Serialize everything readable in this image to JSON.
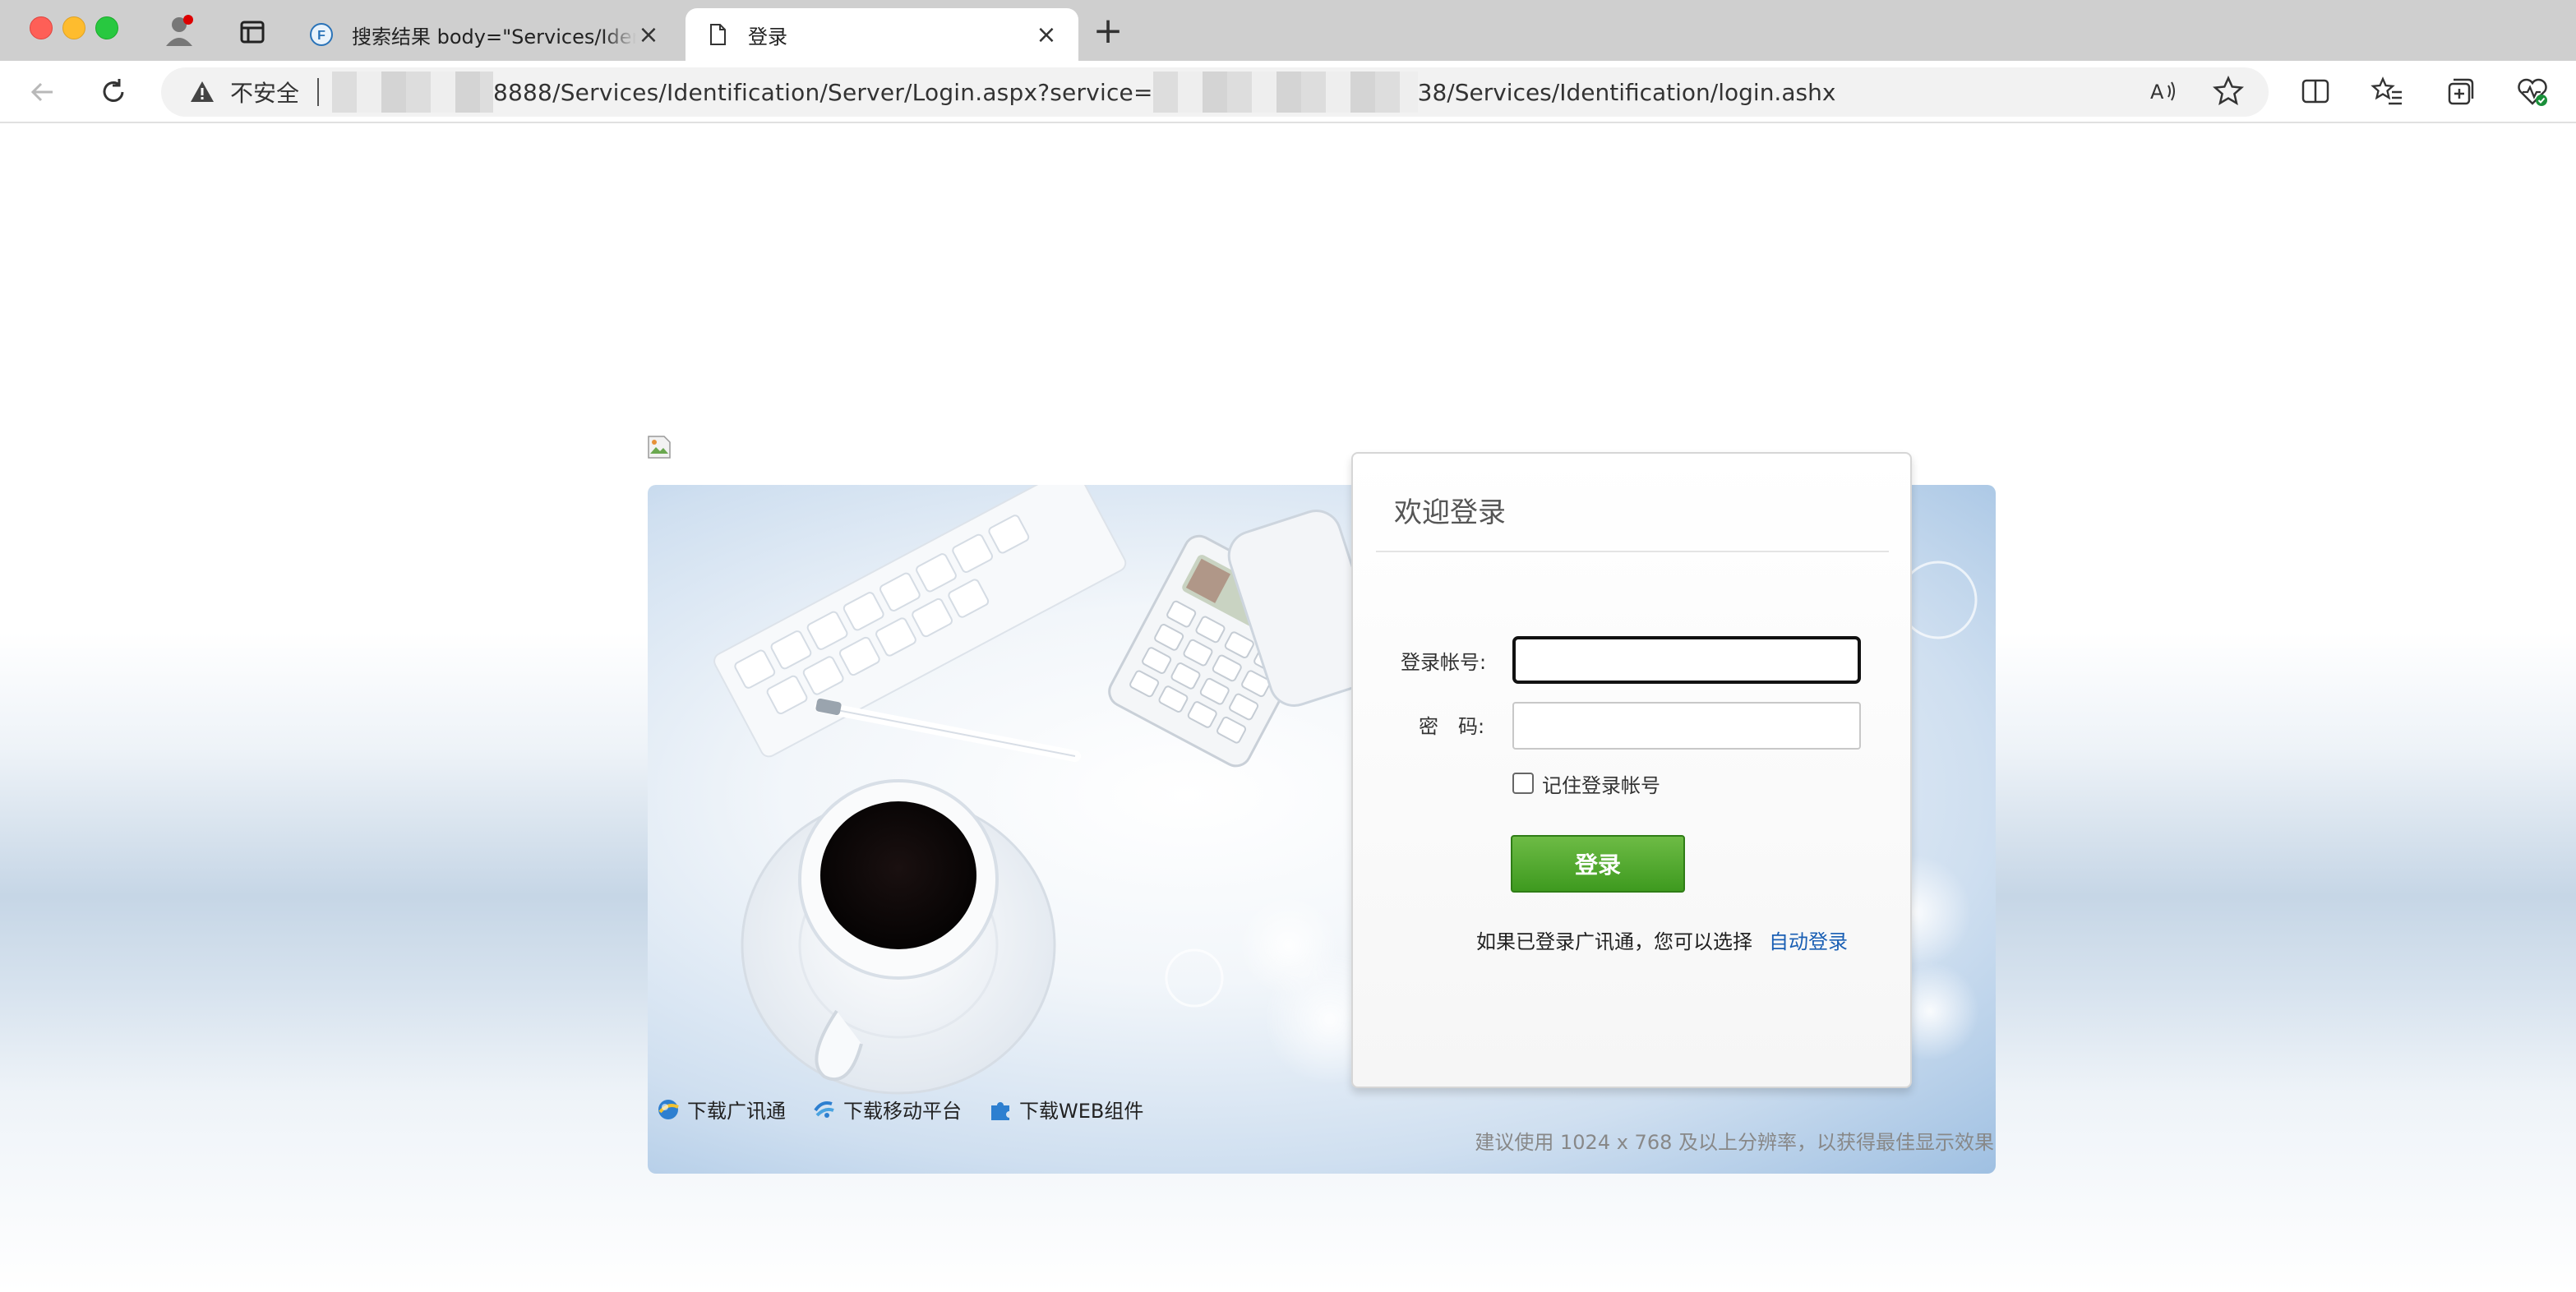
{
  "browser": {
    "tabs": [
      {
        "title": "搜索结果 body=\"Services/Identification/Server/Login.aspx\"",
        "favicon": "fofa-icon"
      },
      {
        "title": "登录",
        "favicon": "page-icon",
        "active": true
      }
    ],
    "address_bar": {
      "security_label": "不安全",
      "url_part1": "8888/Services/Identification/Server/Login.aspx?service=",
      "url_part2": "38/Services/Identification/login.ashx"
    }
  },
  "login": {
    "title": "欢迎登录",
    "account_label": "登录帐号:",
    "password_label": "密　码:",
    "account_value": "",
    "password_value": "",
    "remember_label": "记住登录帐号",
    "submit_label": "登录",
    "auto_login_hint": "如果已登录广讯通，您可以选择",
    "auto_login_link": "自动登录"
  },
  "downloads": [
    {
      "label": "下载广讯通",
      "icon": "gxt-globe-icon"
    },
    {
      "label": "下载移动平台",
      "icon": "mobile-platform-icon"
    },
    {
      "label": "下载WEB组件",
      "icon": "puzzle-icon"
    }
  ],
  "resolution_hint": "建议使用 1024 x 768 及以上分辨率，以获得最佳显示效果",
  "colors": {
    "login_button": "#4ea52a",
    "link": "#1a5fb4",
    "warn": "#444444"
  }
}
